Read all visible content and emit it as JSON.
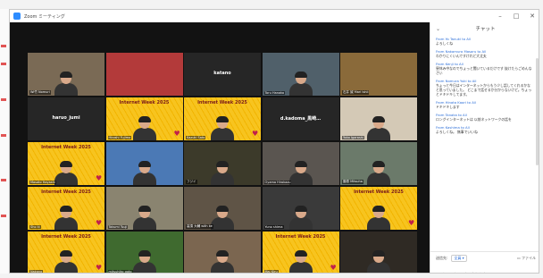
{
  "window": {
    "title": "Zoom ミーティング"
  },
  "controls": {
    "minimize": "–",
    "maximize": "□",
    "close": "✕"
  },
  "tiles": [
    {
      "name": "Wi竹 Nomuri",
      "center_name": "",
      "banner": "",
      "style": "photo",
      "bg": "#7a6a55"
    },
    {
      "name": "",
      "center_name": "",
      "banner": "",
      "style": "food",
      "bg": "#b33a3a"
    },
    {
      "name": "",
      "center_name": "katano",
      "banner": "",
      "style": "blank",
      "bg": "#262626"
    },
    {
      "name": "Toru Hanako",
      "center_name": "",
      "banner": "",
      "style": "photo",
      "bg": "#50606a"
    },
    {
      "name": "石井 誠 Mari Ishii",
      "center_name": "",
      "banner": "",
      "style": "cats",
      "bg": "#8a6a3a"
    },
    {
      "name": "",
      "center_name": "haruo_jumi",
      "banner": "",
      "style": "blank",
      "bg": "#262626"
    },
    {
      "name": "Hiroshi Fujimo",
      "center_name": "",
      "banner": "Internet Week 2025",
      "style": "honey",
      "bg": ""
    },
    {
      "name": "Kazuki Sato",
      "center_name": "",
      "banner": "Internet Week 2025",
      "style": "honey",
      "bg": ""
    },
    {
      "name": "",
      "center_name": "d.kadoma_黒崎…",
      "banner": "",
      "style": "blank",
      "bg": "#262626"
    },
    {
      "name": "Yoko Igarashi",
      "center_name": "",
      "banner": "",
      "style": "photo",
      "bg": "#d4c9b6"
    },
    {
      "name": "Masato Hayashi",
      "center_name": "",
      "banner": "Internet Week 2025",
      "style": "honey",
      "bg": ""
    },
    {
      "name": "",
      "center_name": "",
      "banner": "",
      "style": "photo",
      "bg": "#4b79b5"
    },
    {
      "name": "フジイ",
      "center_name": "",
      "banner": "",
      "style": "photo",
      "bg": "#3c3a2a"
    },
    {
      "name": "Oyama Hirokazu",
      "center_name": "",
      "banner": "",
      "style": "photo",
      "bg": "#5a5550"
    },
    {
      "name": "藤原 Mitsuha",
      "center_name": "",
      "banner": "",
      "style": "photo",
      "bg": "#6b7a6a"
    },
    {
      "name": "Sho ki",
      "center_name": "",
      "banner": "Internet Week 2025",
      "style": "honey",
      "bg": ""
    },
    {
      "name": "Takumi Tsuji",
      "center_name": "",
      "banner": "",
      "style": "photo",
      "bg": "#8a8470"
    },
    {
      "name": "高須 大輔 with ke",
      "center_name": "",
      "banner": "",
      "style": "photo",
      "bg": "#5f5446"
    },
    {
      "name": "Yuno shima",
      "center_name": "",
      "banner": "",
      "style": "photo",
      "bg": "#3a3a3a"
    },
    {
      "name": "",
      "center_name": "",
      "banner": "Internet Week 2025",
      "style": "honey",
      "bg": ""
    },
    {
      "name": "Nakano",
      "center_name": "",
      "banner": "Internet Week 2025",
      "style": "honey",
      "bg": ""
    },
    {
      "name": "mitsuhiko goto",
      "center_name": "",
      "banner": "",
      "style": "photo",
      "bg": "#3f6a2f"
    },
    {
      "name": "",
      "center_name": "",
      "banner": "",
      "style": "photo",
      "bg": "#7b6650"
    },
    {
      "name": "Mai Kiru",
      "center_name": "",
      "banner": "Internet Week 2025",
      "style": "honey",
      "bg": ""
    },
    {
      "name": "",
      "center_name": "",
      "banner": "",
      "style": "photo",
      "bg": "#2f2a24"
    }
  ],
  "chat": {
    "header": "チャット",
    "messages": [
      {
        "from": "From Yo Tanuki to All",
        "text": "よろしくね"
      },
      {
        "from": "From Nakamura Masaru to All",
        "text": "わかりにくいんですけれど大丈夫"
      },
      {
        "from": "From Kenji to All",
        "text": "昼休み中なのでちょっと聞いているだけです 抜けたらごめんなさい"
      },
      {
        "from": "From Nomura Yuki to All",
        "text": "ちょっと今日はインターネットからもう少し話してくれるかなと思っていました。 どこまで話せるか分からないけど。ちょっとドキドキしてます。"
      },
      {
        "from": "From Hinata Kaori to All",
        "text": "ドキドキします"
      },
      {
        "from": "From Tanaka to All",
        "text": "ロングインターネットは 以前ネットワークの話を"
      },
      {
        "from": "From Kashima to All",
        "text": "よろしくね。 無事でいいね"
      }
    ],
    "recipient_label": "送信先:",
    "recipient_value": "全員 ▾",
    "file_label": "ファイル",
    "input_placeholder": "ここにメッセージを入力します..."
  }
}
